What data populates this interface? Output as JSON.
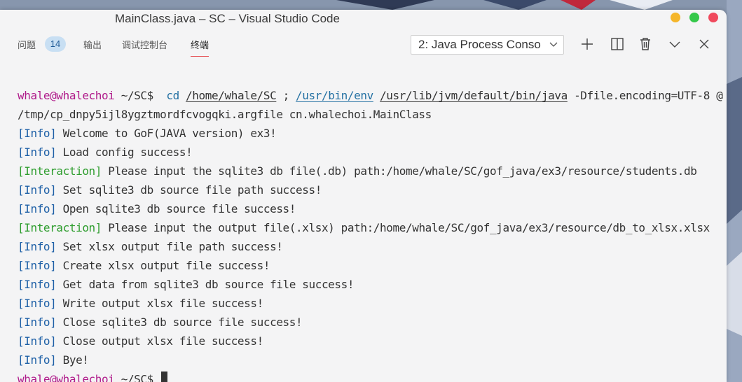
{
  "window": {
    "title": "MainClass.java – SC – Visual Studio Code"
  },
  "panel": {
    "tabs": [
      {
        "label": "问题",
        "badge": "14"
      },
      {
        "label": "输出"
      },
      {
        "label": "调试控制台"
      },
      {
        "label": "终端",
        "active": true
      }
    ],
    "terminal_select": "2: Java Process Conso",
    "actions": [
      "plus-icon",
      "split-icon",
      "trash-icon",
      "chevron-down-icon",
      "close-icon"
    ]
  },
  "terminal": {
    "prompt_user": "whale@whalechoi",
    "prompt_path": "~/SC$",
    "command": {
      "cd": "cd",
      "cd_path": "/home/whale/SC",
      "sep": ";",
      "env": "/usr/bin/env",
      "java": "/usr/lib/jvm/default/bin/java",
      "args": "-Dfile.encoding=UTF-8 @",
      "args_cont": "/tmp/cp_dnpy5ijl8ygztmordfcvogqki.argfile cn.whalechoi.MainClass"
    },
    "lines": [
      {
        "tag": "[Info]",
        "text": "Welcome to GoF(JAVA version) ex3!"
      },
      {
        "tag": "[Info]",
        "text": "Load config success!"
      },
      {
        "tag": "[Interaction]",
        "text": "Please input the sqlite3 db file(.db) path:/home/whale/SC/gof_java/ex3/resource/students.db"
      },
      {
        "tag": "[Info]",
        "text": "Set sqlite3 db source file path success!"
      },
      {
        "tag": "[Info]",
        "text": "Open sqlite3 db source file success!"
      },
      {
        "tag": "[Interaction]",
        "text": "Please input the output file(.xlsx) path:/home/whale/SC/gof_java/ex3/resource/db_to_xlsx.xlsx"
      },
      {
        "tag": "[Info]",
        "text": "Set xlsx output file path success!"
      },
      {
        "tag": "[Info]",
        "text": "Create xlsx output file success!"
      },
      {
        "tag": "[Info]",
        "text": "Get data from sqlite3 db source file success!"
      },
      {
        "tag": "[Info]",
        "text": "Write output xlsx file success!"
      },
      {
        "tag": "[Info]",
        "text": "Close sqlite3 db source file success!"
      },
      {
        "tag": "[Info]",
        "text": "Close output xlsx file success!"
      },
      {
        "tag": "[Info]",
        "text": "Bye!"
      }
    ]
  },
  "colors": {
    "user": "#b01c8b",
    "path": "#2471a3",
    "info": "#1d5fa6",
    "interaction": "#2e9d2e",
    "active_tab_underline": "#e5484d"
  }
}
